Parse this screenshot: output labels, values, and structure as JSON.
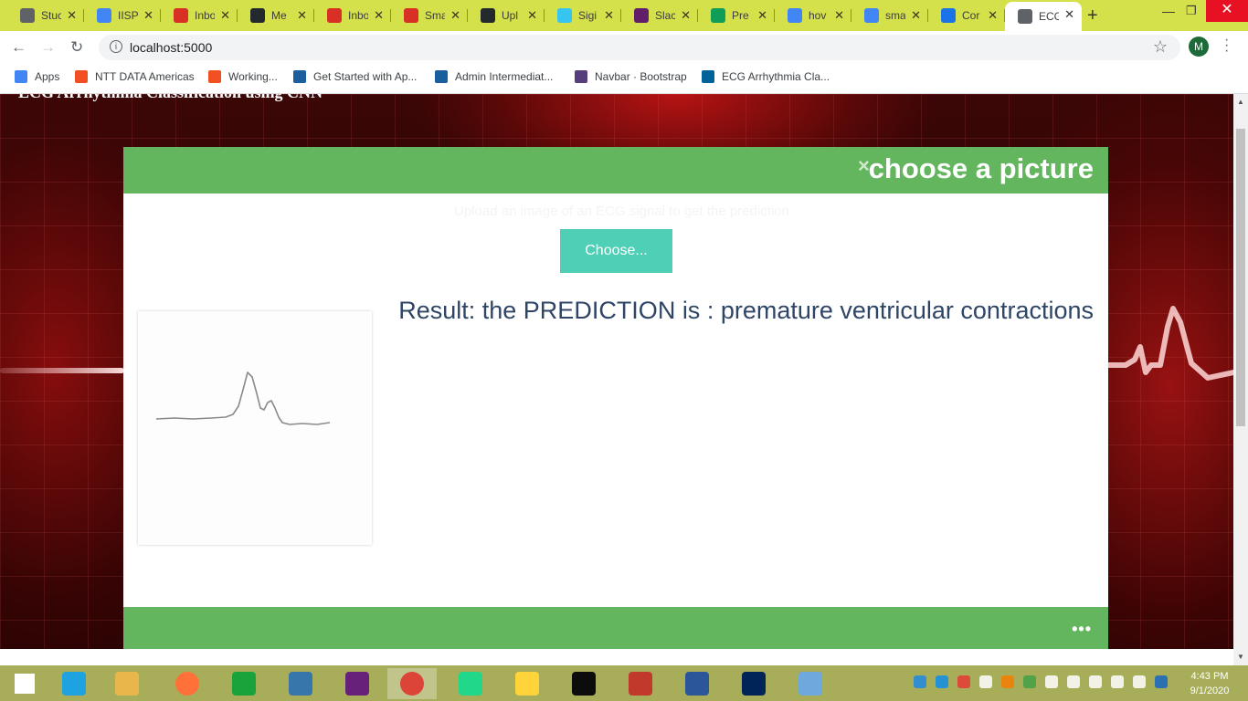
{
  "browser": {
    "tabs": [
      {
        "label": "Stuc",
        "icon": "globe-icon",
        "color": "#5f6368"
      },
      {
        "label": "IISP",
        "icon": "document-icon",
        "color": "#4285f4"
      },
      {
        "label": "Inbo",
        "icon": "gmail-icon",
        "color": "#d93025"
      },
      {
        "label": "Me",
        "icon": "github-icon",
        "color": "#24292e"
      },
      {
        "label": "Inbo",
        "icon": "gmail-icon",
        "color": "#d93025"
      },
      {
        "label": "Sma",
        "icon": "gmail-icon",
        "color": "#d93025"
      },
      {
        "label": "Upl",
        "icon": "github-icon",
        "color": "#24292e"
      },
      {
        "label": "Sigi",
        "icon": "slack-icon",
        "color": "#36c5f0"
      },
      {
        "label": "Slac",
        "icon": "slack-icon",
        "color": "#611f69"
      },
      {
        "label": "Pre",
        "icon": "drive-icon",
        "color": "#0f9d58"
      },
      {
        "label": "hov",
        "icon": "google-icon",
        "color": "#4285f4"
      },
      {
        "label": "sma",
        "icon": "google-icon",
        "color": "#4285f4"
      },
      {
        "label": "Cor",
        "icon": "calendar-icon",
        "color": "#1a73e8"
      },
      {
        "label": "ECG",
        "icon": "globe-icon",
        "color": "#5f6368",
        "active": true
      }
    ],
    "url": "localhost:5000",
    "profile_initial": "M",
    "bookmarks": [
      {
        "label": "Apps",
        "icon": "apps-grid-icon",
        "color": "#4285f4"
      },
      {
        "label": "NTT DATA Americas",
        "icon": "windows-logo-icon",
        "color": "#f25022"
      },
      {
        "label": "Working...",
        "icon": "windows-logo-icon",
        "color": "#f25022"
      },
      {
        "label": "Get Started with Ap...",
        "icon": "cloud-icon",
        "color": "#1b5e9e"
      },
      {
        "label": "Admin Intermediat...",
        "icon": "cloud-icon",
        "color": "#1b5e9e"
      },
      {
        "label": "Navbar · Bootstrap",
        "icon": "bootstrap-icon",
        "color": "#563d7c"
      },
      {
        "label": "ECG Arrhythmia Cla...",
        "icon": "ieee-icon",
        "color": "#00629b"
      }
    ]
  },
  "page": {
    "heading": "ECG Arrhythmia Classification using CNN",
    "modal": {
      "title": "choose a picture",
      "close_symbol": "×",
      "ghost_text": "Upload an image of an ECG signal to get the prediction",
      "choose_label": "Choose...",
      "result_text": "Result: the PREDICTION is : premature ventricular contractions",
      "footer_more": "•••"
    }
  },
  "taskbar": {
    "time": "4:43 PM",
    "date": "9/1/2020",
    "apps": [
      {
        "name": "start-button",
        "color": "#ffffff"
      },
      {
        "name": "internet-explorer-icon",
        "color": "#1ea2e0"
      },
      {
        "name": "file-explorer-icon",
        "color": "#e8b64a"
      },
      {
        "name": "firefox-icon",
        "color": "#ff7139"
      },
      {
        "name": "store-icon",
        "color": "#1aa33a"
      },
      {
        "name": "python-icon",
        "color": "#3776ab"
      },
      {
        "name": "visual-studio-icon",
        "color": "#68217a"
      },
      {
        "name": "chrome-icon",
        "color": "#db4437"
      },
      {
        "name": "pycharm-icon",
        "color": "#21d789"
      },
      {
        "name": "python-launcher-icon",
        "color": "#ffd43b"
      },
      {
        "name": "terminal-icon",
        "color": "#0c0c0c"
      },
      {
        "name": "spyder-icon",
        "color": "#c0392b"
      },
      {
        "name": "word-icon",
        "color": "#2b579a"
      },
      {
        "name": "powershell-icon",
        "color": "#012456"
      },
      {
        "name": "paint-icon",
        "color": "#6fa8dc"
      }
    ]
  }
}
